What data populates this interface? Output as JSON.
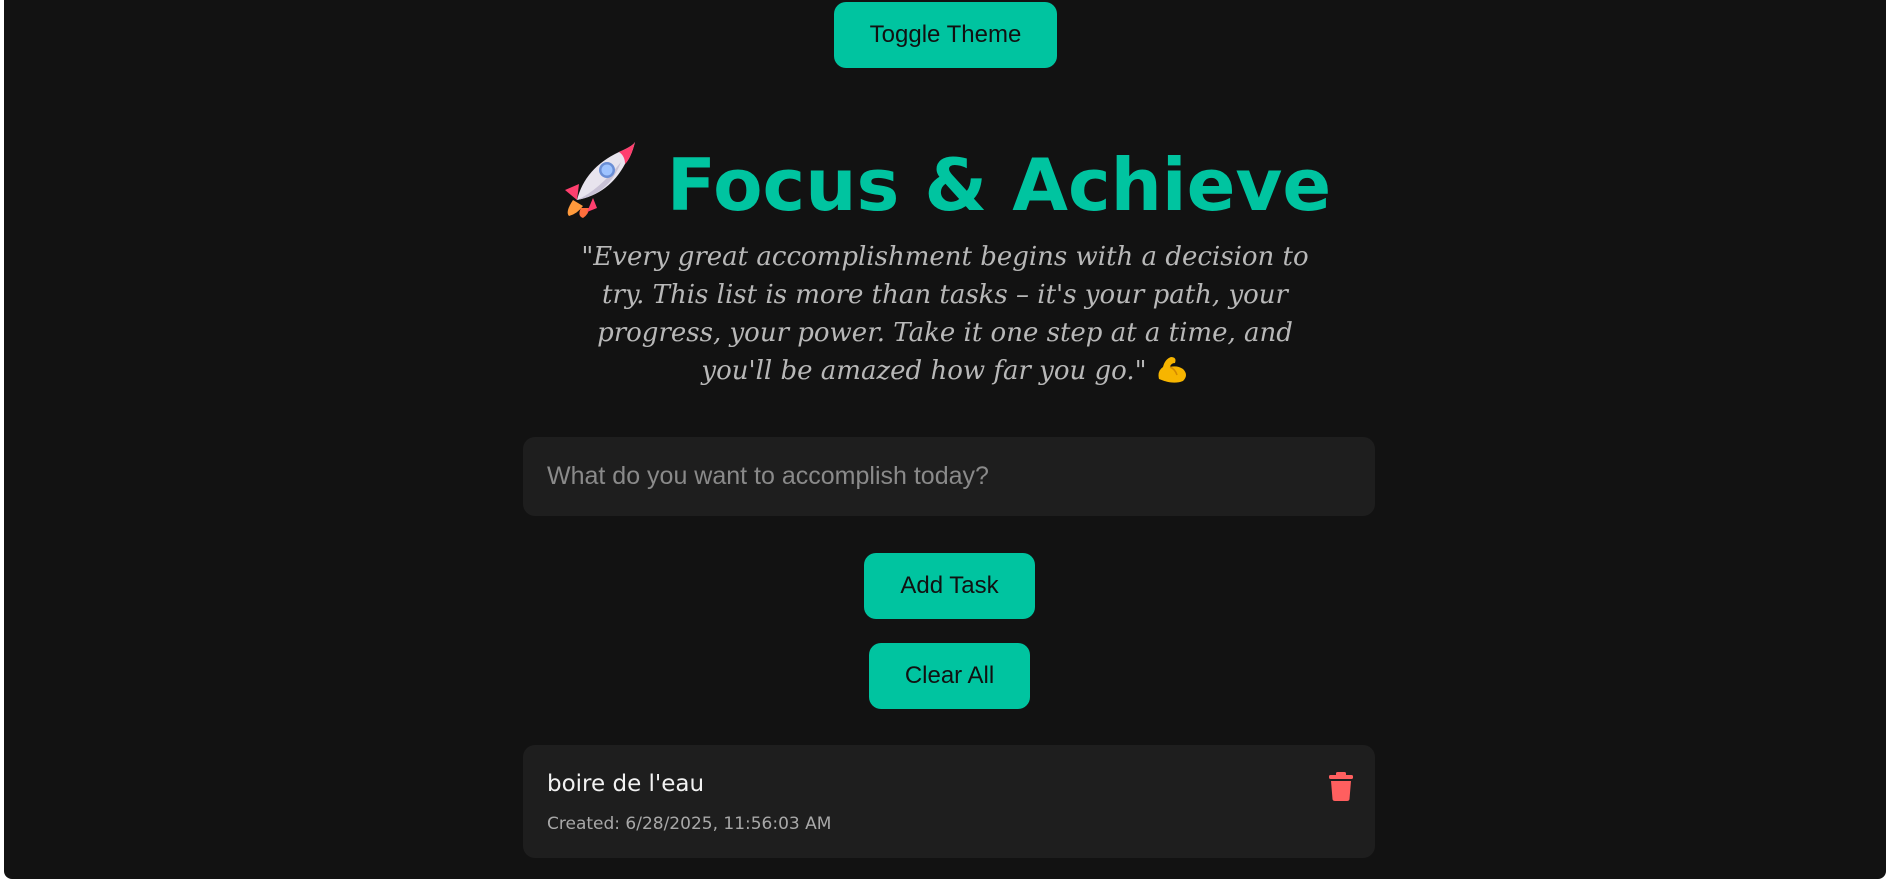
{
  "header": {
    "toggle_theme_label": "Toggle Theme",
    "title": "Focus & Achieve",
    "title_icon": "rocket-icon",
    "quote": "\"Every great accomplishment begins with a decision to try. This list is more than tasks – it's your path, your progress, your power. Take it one step at a time, and you'll be amazed how far you go.\"",
    "quote_icon": "flexed-biceps-icon"
  },
  "form": {
    "placeholder": "What do you want to accomplish today?",
    "value": "",
    "add_label": "Add Task",
    "clear_label": "Clear All"
  },
  "tasks": [
    {
      "text": "boire de l'eau",
      "created": "Created: 6/28/2025, 11:56:03 AM",
      "delete_icon": "trash-icon"
    }
  ],
  "colors": {
    "accent": "#00c4a0",
    "background": "#121212",
    "card": "#1e1e1e",
    "danger": "#ff5f5f"
  }
}
